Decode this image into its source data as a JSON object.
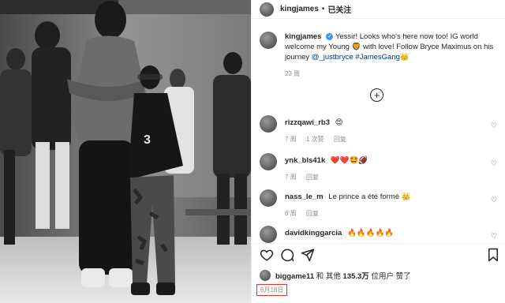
{
  "post": {
    "author": "kingjames",
    "separator": "•",
    "follow_label": "已关注",
    "caption_user": "kingjames",
    "caption_text_1": "Yessir! Looks who's here now too! IG world welcome my Young",
    "caption_text_2": "with love! Follow Bryce Maximus on his journey",
    "caption_mention": "@_justbryce",
    "caption_hashtag": "#JamesGang",
    "caption_emoji_end": "👑",
    "caption_emoji_mid": "🦁",
    "caption_time": "23 周"
  },
  "comments": [
    {
      "user": "rizzqawi_rb3",
      "text": "😍",
      "time": "7 周",
      "extra": "1 次赞",
      "reply": "回复"
    },
    {
      "user": "ynk_bls41k",
      "text": "❤️❤️🤩🏈",
      "time": "7 周",
      "extra": "",
      "reply": "回复"
    },
    {
      "user": "nass_le_m",
      "text": "Le prince a été formé 👑",
      "time": "6 周",
      "extra": "",
      "reply": "回复"
    },
    {
      "user": "davidkinggarcia",
      "text": "🔥🔥🔥🔥🔥",
      "time": "",
      "extra": "",
      "reply": ""
    }
  ],
  "likes": {
    "user": "biggame11",
    "connector": "和 其他",
    "count": "135.3万",
    "suffix": "位用户 赞了"
  },
  "date": "6月18日",
  "icons": {
    "like": "heart-icon",
    "comment": "comment-icon",
    "share": "send-icon",
    "save": "bookmark-icon",
    "load_more": "plus-circle-icon",
    "verified": "verified-badge-icon"
  },
  "colors": {
    "link": "#00376b",
    "verified": "#3897f0",
    "date_outline": "#e3342f"
  }
}
